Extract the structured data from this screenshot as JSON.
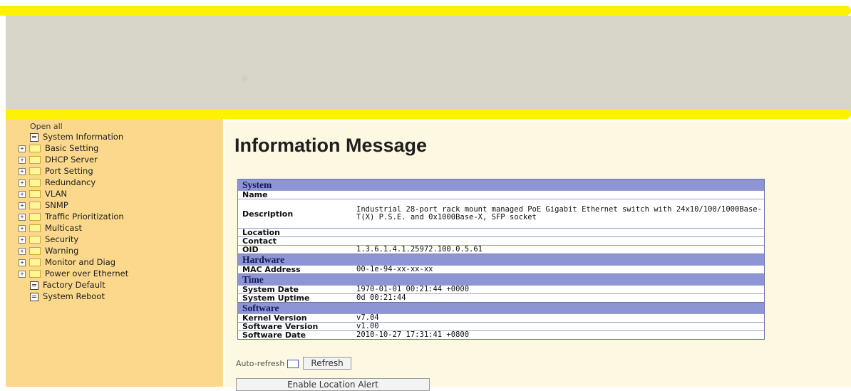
{
  "sidebar": {
    "open_all": "Open all",
    "items": [
      {
        "label": "System Information",
        "icon": "page-icon"
      },
      {
        "label": "Basic Setting",
        "icon": "folder-icon"
      },
      {
        "label": "DHCP Server",
        "icon": "folder-icon"
      },
      {
        "label": "Port Setting",
        "icon": "folder-icon"
      },
      {
        "label": "Redundancy",
        "icon": "folder-icon"
      },
      {
        "label": "VLAN",
        "icon": "folder-icon"
      },
      {
        "label": "SNMP",
        "icon": "folder-icon"
      },
      {
        "label": "Traffic Prioritization",
        "icon": "folder-icon"
      },
      {
        "label": "Multicast",
        "icon": "folder-icon"
      },
      {
        "label": "Security",
        "icon": "folder-icon"
      },
      {
        "label": "Warning",
        "icon": "folder-icon"
      },
      {
        "label": "Monitor and Diag",
        "icon": "folder-icon"
      },
      {
        "label": "Power over Ethernet",
        "icon": "folder-icon"
      },
      {
        "label": "Factory Default",
        "icon": "page-icon"
      },
      {
        "label": "System Reboot",
        "icon": "page-icon"
      }
    ]
  },
  "main": {
    "title": "Information Message",
    "sections": {
      "system": "System",
      "hardware": "Hardware",
      "time": "Time",
      "software": "Software"
    },
    "system": {
      "name_label": "Name",
      "name_value": "",
      "description_label": "Description",
      "description_value": "Industrial 28-port rack mount managed PoE Gigabit Ethernet switch with 24x10/100/1000Base-T(X) P.S.E. and 0x1000Base-X, SFP socket",
      "location_label": "Location",
      "contact_label": "Contact",
      "oid_label": "OID",
      "oid_value": "1.3.6.1.4.1.25972.100.0.5.61"
    },
    "hardware": {
      "mac_label": "MAC Address",
      "mac_value": "00-1e-94-xx-xx-xx"
    },
    "time": {
      "system_date_label": "System Date",
      "system_date_value": "1970-01-01 00:21:44 +0000",
      "system_uptime_label": "System Uptime",
      "system_uptime_value": "0d 00:21:44"
    },
    "software": {
      "kernel_label": "Kernel Version",
      "kernel_value": "v7.04",
      "software_label": "Software Version",
      "software_value": "v1.00",
      "date_label": "Software Date",
      "date_value": "2010-10-27 17:31:41 +0800"
    },
    "auto_refresh_label": "Auto-refresh",
    "refresh_button": "Refresh",
    "enable_alert_button": "Enable Location Alert"
  }
}
